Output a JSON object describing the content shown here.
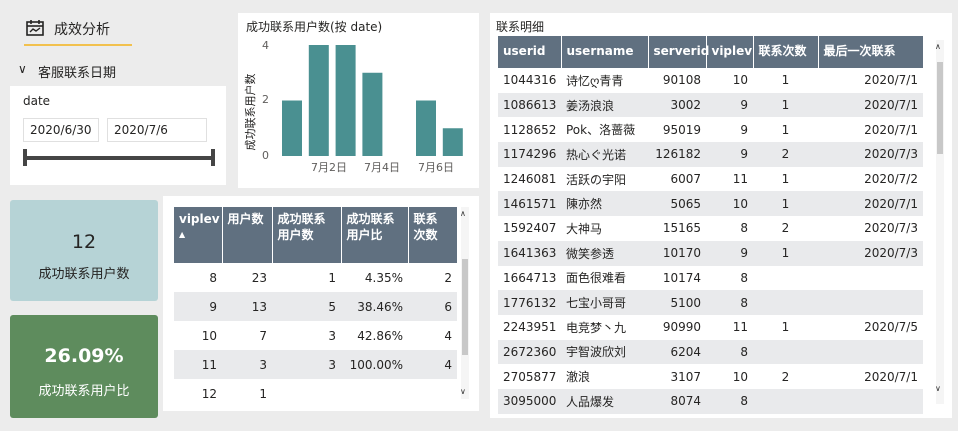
{
  "tab": {
    "label": "成效分析"
  },
  "slicer": {
    "header": "客服联系日期",
    "field": "date",
    "start": "2020/6/30",
    "end": "2020/7/6"
  },
  "bar_chart": {
    "title": "成功联系用户数(按 date)",
    "ylabel": "成功联系用户数",
    "yticks": [
      "4",
      "2",
      "0"
    ],
    "xticks": [
      "7月2日",
      "7月4日",
      "7月6日"
    ]
  },
  "chart_data": {
    "type": "bar",
    "title": "成功联系用户数(按 date)",
    "xlabel": "",
    "ylabel": "成功联系用户数",
    "categories": [
      "2020/6/30",
      "2020/7/1",
      "2020/7/2",
      "2020/7/3",
      "2020/7/4",
      "2020/7/5",
      "2020/7/6"
    ],
    "values": [
      2,
      4,
      4,
      3,
      0,
      2,
      1
    ],
    "ylim": [
      0,
      4
    ],
    "color": "#4a9091",
    "grid": false
  },
  "kpi1": {
    "value": "12",
    "label": "成功联系用户数"
  },
  "kpi2": {
    "value": "26.09%",
    "label": "成功联系用户比"
  },
  "vip_table": {
    "headers": [
      "viplev",
      "用户数",
      "成功联系用户数",
      "成功联系用户比",
      "联系次数"
    ],
    "header_lines": [
      [
        "viplev",
        "▲"
      ],
      [
        "用户数"
      ],
      [
        "成功联系",
        "用户数"
      ],
      [
        "成功联系",
        "用户比"
      ],
      [
        "联系",
        "次数"
      ]
    ],
    "rows": [
      [
        "8",
        "23",
        "1",
        "4.35%",
        "2"
      ],
      [
        "9",
        "13",
        "5",
        "38.46%",
        "6"
      ],
      [
        "10",
        "7",
        "3",
        "42.86%",
        "4"
      ],
      [
        "11",
        "3",
        "3",
        "100.00%",
        "4"
      ],
      [
        "12",
        "1",
        "",
        "",
        ""
      ]
    ]
  },
  "detail_table": {
    "title": "联系明细",
    "headers": [
      "userid",
      "username",
      "serverid",
      "viplev",
      "联系次数",
      "最后一次联系"
    ],
    "rows": [
      [
        "1044316",
        "诗忆ღ青青",
        "90108",
        "10",
        "1",
        "2020/7/1"
      ],
      [
        "1086613",
        "姜汤浪浪",
        "3002",
        "9",
        "1",
        "2020/7/1"
      ],
      [
        "1128652",
        "Pok、洛蔷薇",
        "95019",
        "9",
        "1",
        "2020/7/1"
      ],
      [
        "1174296",
        "热心ぐ光诺",
        "126182",
        "9",
        "2",
        "2020/7/3"
      ],
      [
        "1246081",
        "活跃の宇阳",
        "6007",
        "11",
        "1",
        "2020/7/2"
      ],
      [
        "1461571",
        "陳亦然",
        "5065",
        "10",
        "1",
        "2020/7/1"
      ],
      [
        "1592407",
        "大神马",
        "15165",
        "8",
        "2",
        "2020/7/3"
      ],
      [
        "1641363",
        "微笑参透",
        "10170",
        "9",
        "1",
        "2020/7/3"
      ],
      [
        "1664713",
        "面色很难看",
        "10174",
        "8",
        "",
        ""
      ],
      [
        "1776132",
        "七宝小哥哥",
        "5100",
        "8",
        "",
        ""
      ],
      [
        "2243951",
        "电竞梦丶九",
        "90990",
        "11",
        "1",
        "2020/7/5"
      ],
      [
        "2672360",
        "宇智波欣刘",
        "6204",
        "8",
        "",
        ""
      ],
      [
        "2705877",
        "澈浪",
        "3107",
        "10",
        "2",
        "2020/7/1"
      ],
      [
        "3095000",
        "人品爆发",
        "8074",
        "8",
        "",
        ""
      ]
    ]
  }
}
